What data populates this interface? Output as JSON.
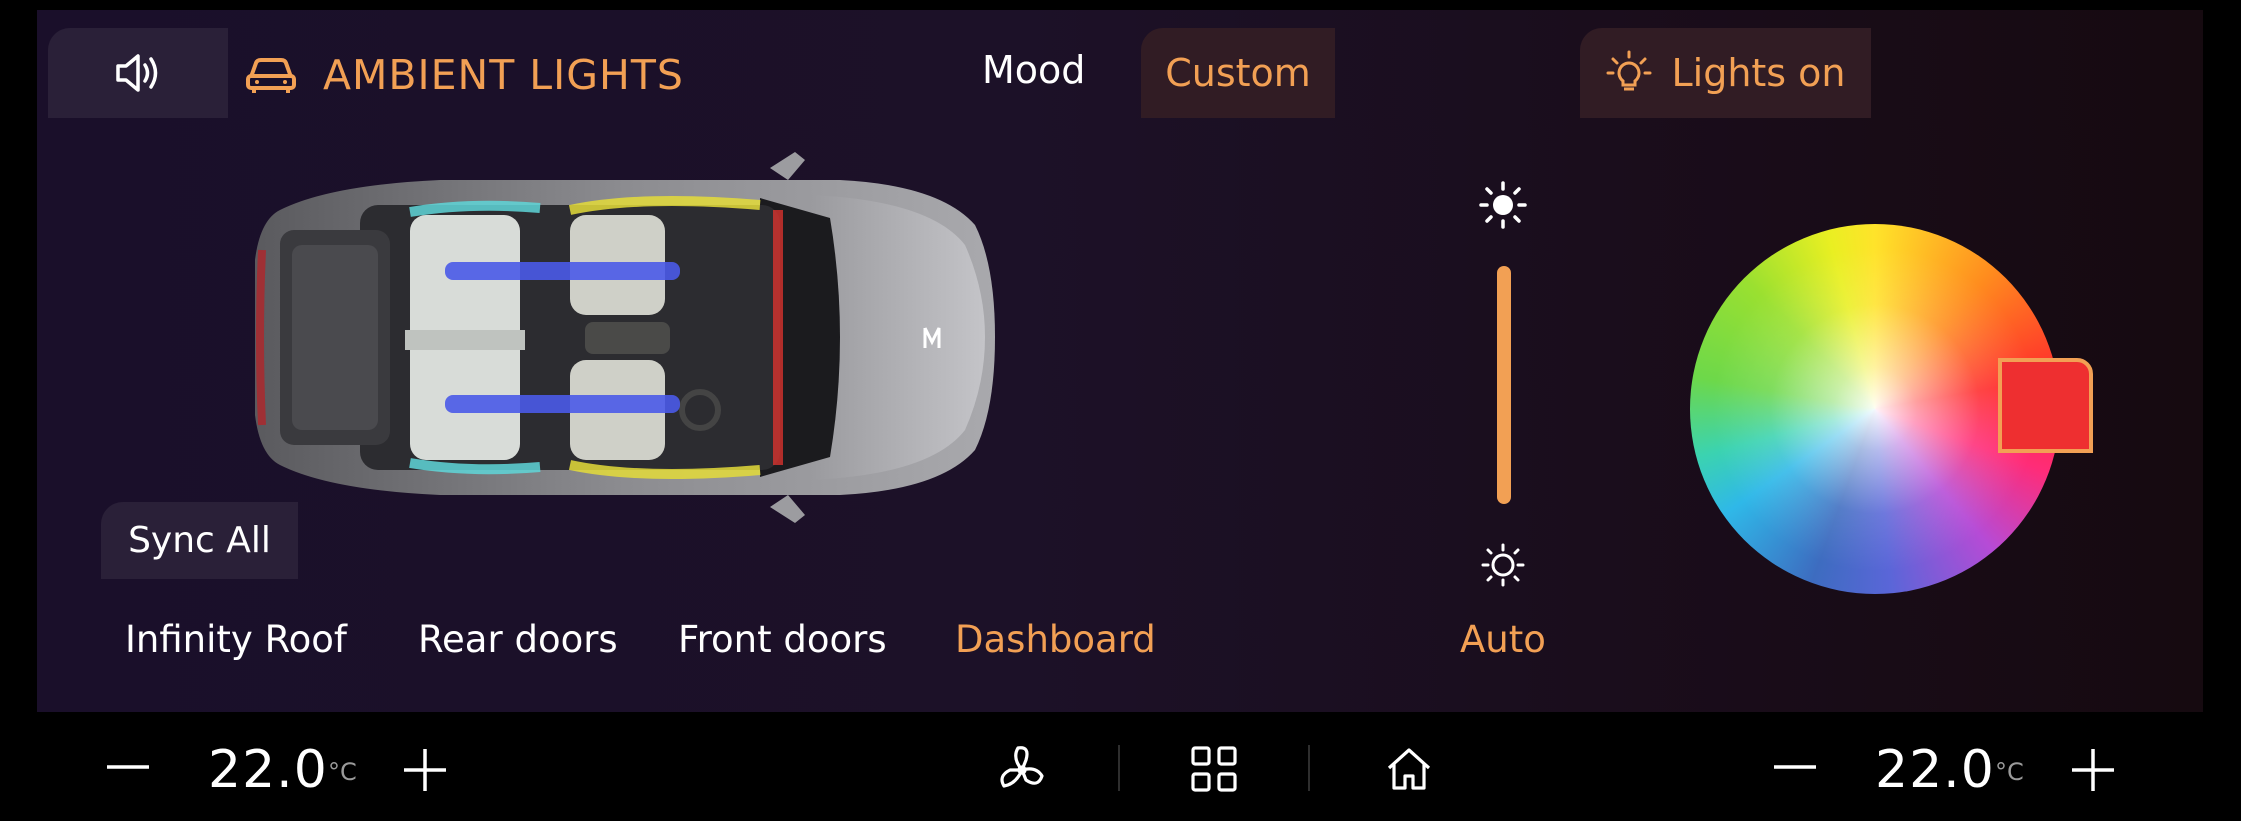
{
  "header": {
    "title": "AMBIENT LIGHTS",
    "mood_label": "Mood",
    "custom_label": "Custom",
    "lights_label": "Lights on"
  },
  "sync_label": "Sync All",
  "zones": [
    {
      "label": "Infinity Roof",
      "active": false
    },
    {
      "label": "Rear doors",
      "active": false
    },
    {
      "label": "Front doors",
      "active": false
    },
    {
      "label": "Dashboard",
      "active": true
    }
  ],
  "brightness": {
    "auto_label": "Auto",
    "level": 1.0
  },
  "color": {
    "selected": "#ee2f30",
    "accent": "#f2a054"
  },
  "climate": {
    "left": {
      "value": "22.0",
      "unit": "°C"
    },
    "right": {
      "value": "22.0",
      "unit": "°C"
    }
  },
  "icons": [
    "speaker-icon",
    "car-icon",
    "bulb-icon",
    "sun-bright-icon",
    "sun-dim-icon",
    "minus-icon",
    "plus-icon",
    "fan-icon",
    "grid-icon",
    "home-icon"
  ]
}
